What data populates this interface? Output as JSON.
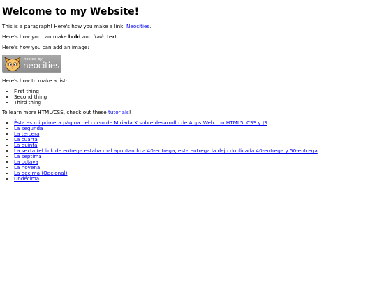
{
  "header": {
    "title": "Welcome to my Website!"
  },
  "paragraph1": {
    "text_before": "This is a paragraph! Here's how you make a link: ",
    "link_label": "Neocities",
    "text_after": "."
  },
  "paragraph2": {
    "text_before": "Here's how you can make ",
    "bold": "bold",
    "text_middle": " and ",
    "italic": "italic",
    "text_after": " text."
  },
  "paragraph3": {
    "text": "Here's how you can add an image:"
  },
  "badge": {
    "line1": "hosted by",
    "line2": "neocities"
  },
  "paragraph4": {
    "text": "Here's how to make a list:"
  },
  "list": [
    "First thing",
    "Second thing",
    "Third thing"
  ],
  "paragraph5": {
    "text_before": "To learn more HTML/CSS, check out these ",
    "link_label": "tutorials",
    "text_after": "!"
  },
  "links": [
    "Ésta es mi primera página del curso de Miriada X sobre desarrollo de Apps Web con HTML5, CSS y JS",
    "La segunda",
    "La tercera",
    "La cuarta",
    "La quinta",
    "La sexta (el link de entrega estaba mal apuntando a 40-entrega, esta entrega la dejo duplicada 40-entrega y 50-entrega",
    "La septima",
    "La octava",
    "La novena",
    "La decima (Opcional)",
    "Undécima"
  ],
  "colors": {
    "link": "#0000ee",
    "badge_bg": "#999999",
    "cat_orange": "#f0a030"
  }
}
